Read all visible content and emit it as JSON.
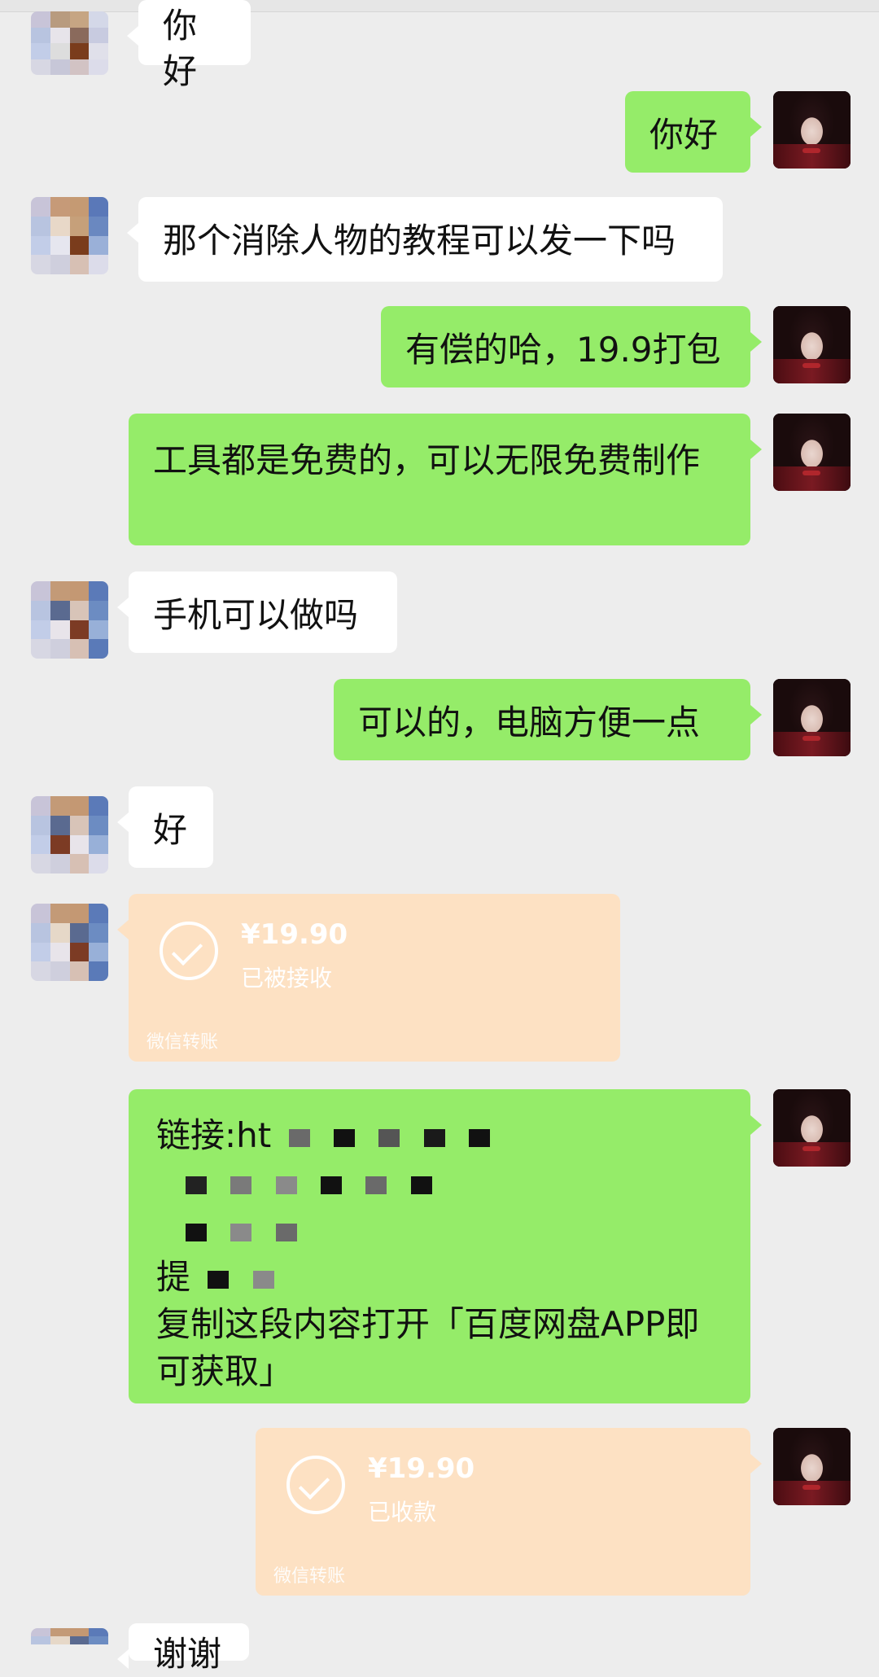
{
  "messages": [
    {
      "side": "left",
      "text": "你好"
    },
    {
      "side": "right",
      "text": "你好"
    },
    {
      "side": "left",
      "text": "那个消除人物的教程可以发一下吗"
    },
    {
      "side": "right",
      "text": "有偿的哈，19.9打包"
    },
    {
      "side": "right",
      "text": "工具都是免费的，可以无限免费制作"
    },
    {
      "side": "left",
      "text": "手机可以做吗"
    },
    {
      "side": "right",
      "text": "可以的，电脑方便一点"
    },
    {
      "side": "left",
      "text": "好"
    },
    {
      "side": "left",
      "type": "transfer",
      "amount": "¥19.90",
      "status": "已被接收",
      "label": "微信转账"
    },
    {
      "side": "right",
      "type": "link",
      "line1": "链接:ht",
      "line5": "提",
      "line6": "复制这段内容打开「百度网盘APP即可获取」"
    },
    {
      "side": "right",
      "type": "transfer",
      "amount": "¥19.90",
      "status": "已收款",
      "label": "微信转账"
    },
    {
      "side": "left",
      "text": "谢谢"
    }
  ],
  "colors": {
    "background": "#ededed",
    "bubble_green": "#95ec69",
    "bubble_white": "#ffffff",
    "transfer": "#fde1c3"
  }
}
